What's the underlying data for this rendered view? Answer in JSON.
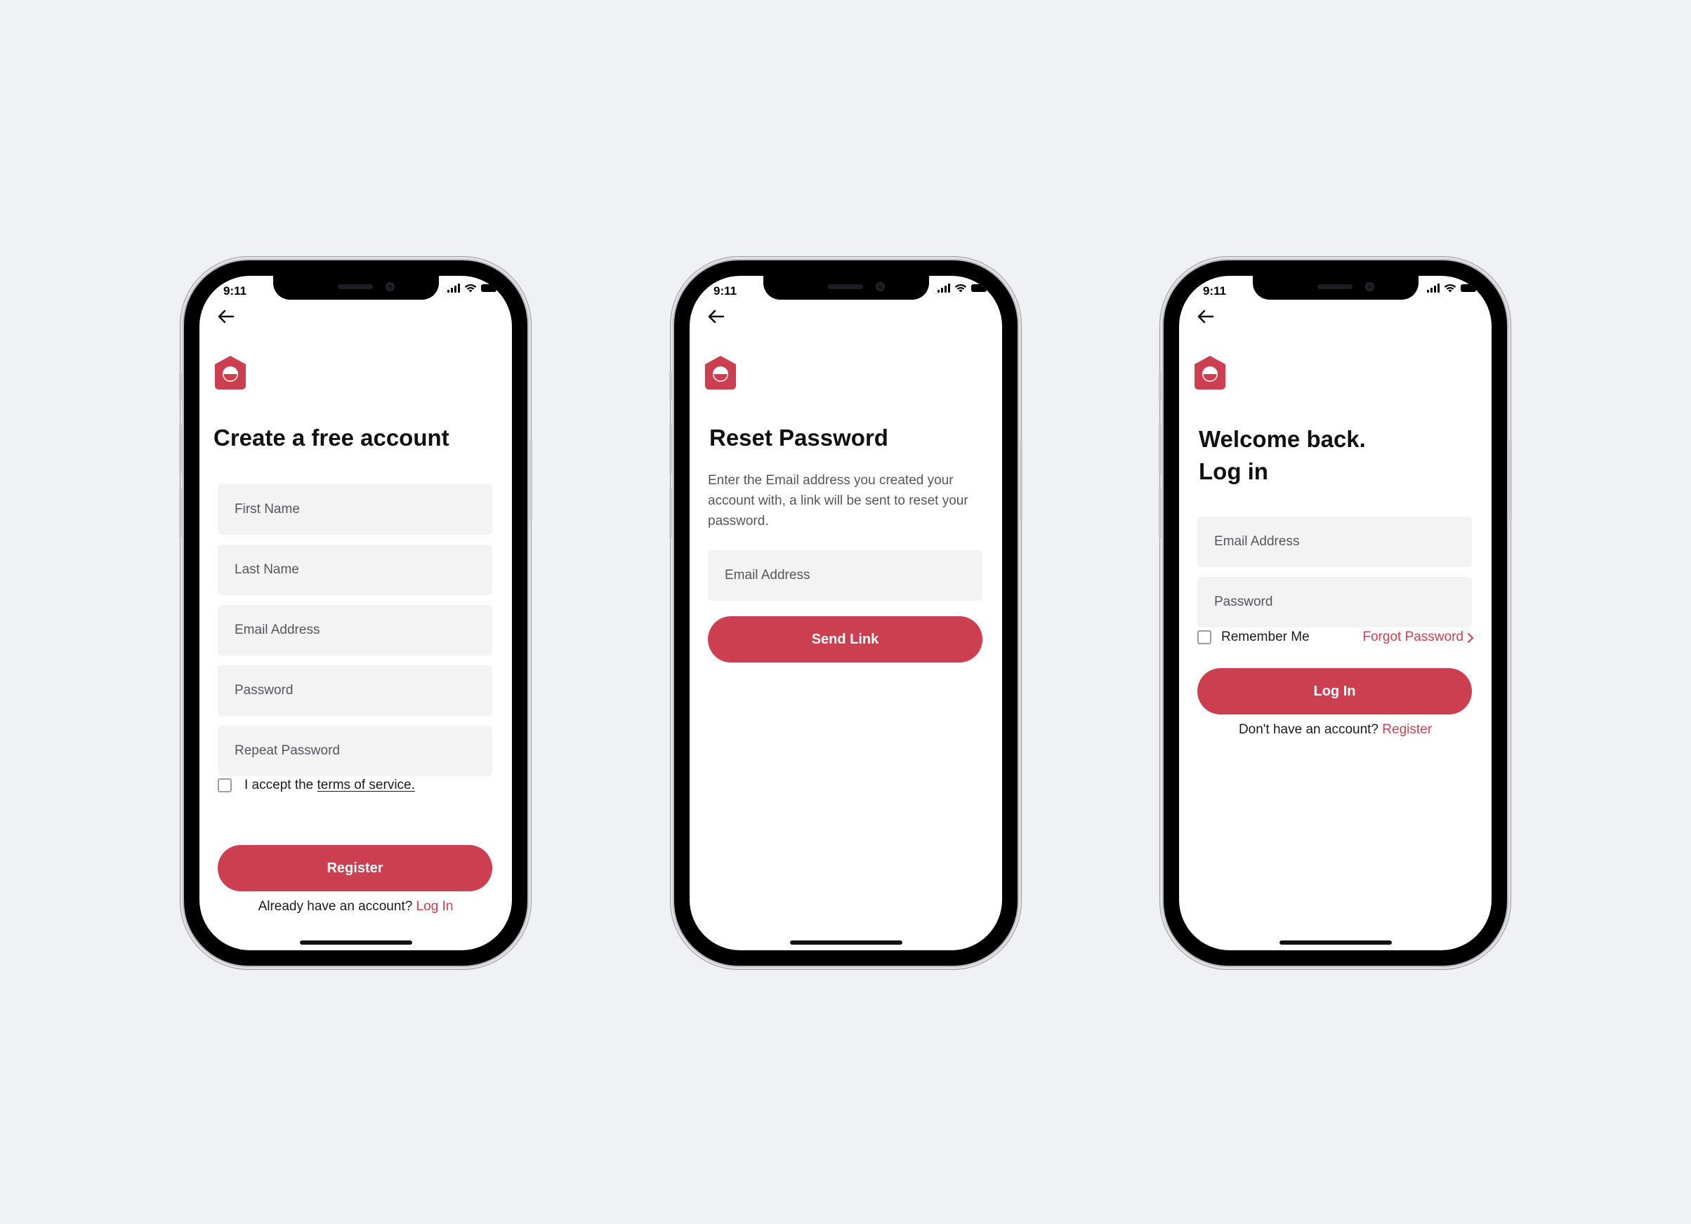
{
  "status": {
    "time": "9:11"
  },
  "register": {
    "title": "Create a free account",
    "fields": [
      "First Name",
      "Last Name",
      "Email Address",
      "Password",
      "Repeat Password"
    ],
    "accept_prefix": "I accept the",
    "terms_link": "terms of service.",
    "button": "Register",
    "footer_text": "Already have an account?",
    "footer_link": "Log In"
  },
  "reset": {
    "title": "Reset Password",
    "description": "Enter the Email address you created your account with, a link will be sent to reset your password.",
    "email_placeholder": "Email Address",
    "button": "Send Link"
  },
  "login": {
    "title_line1": "Welcome back.",
    "title_line2": "Log in",
    "email_placeholder": "Email Address",
    "password_placeholder": "Password",
    "remember_me": "Remember Me",
    "forgot_password": "Forgot Password",
    "button": "Log In",
    "footer_text": "Don't have an account?",
    "footer_link": "Register"
  },
  "colors": {
    "accent": "#cc3f50",
    "background": "#f0f1f5",
    "field": "#f3f3f4"
  }
}
